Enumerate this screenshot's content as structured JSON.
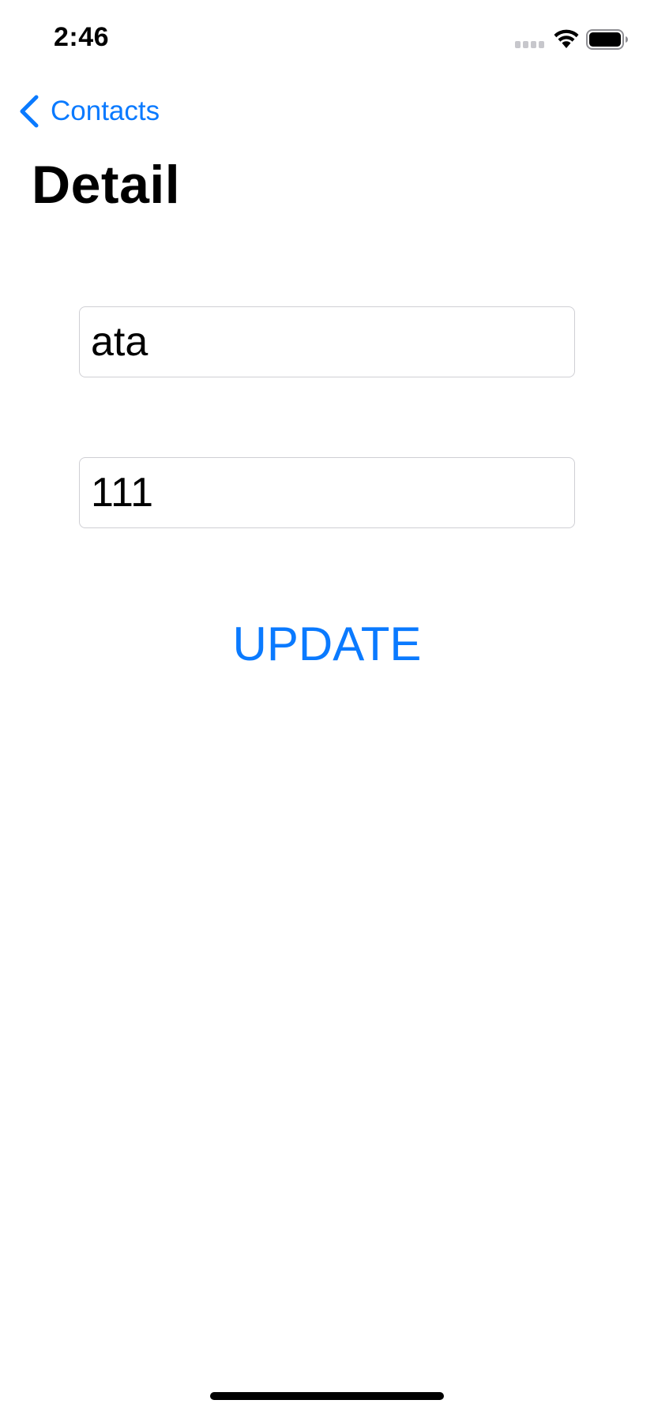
{
  "status_bar": {
    "time": "2:46",
    "icons": [
      "cellular-signal-icon",
      "wifi-icon",
      "battery-icon"
    ]
  },
  "nav": {
    "back_label": "Contacts",
    "back_icon": "chevron-left-icon",
    "title": "Detail"
  },
  "form": {
    "name_value": "ata",
    "phone_value": "111",
    "update_label": "UPDATE"
  },
  "colors": {
    "accent": "#0a7aff",
    "text": "#000000",
    "field_border": "#cfcfd4",
    "background": "#ffffff"
  }
}
